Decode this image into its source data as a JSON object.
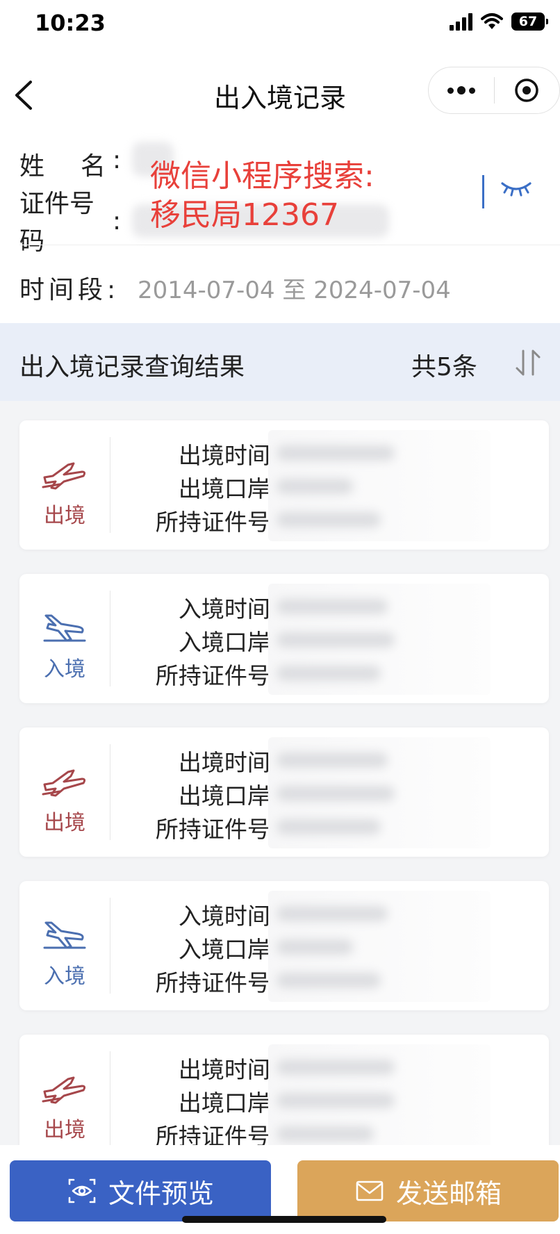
{
  "status_bar": {
    "time": "10:23",
    "battery": "67"
  },
  "nav": {
    "title": "出入境记录"
  },
  "info": {
    "name_label": "姓名",
    "id_label_line1": "证件号",
    "id_label_line2": "码",
    "colon": ":",
    "watermark_line1": "微信小程序搜索:",
    "watermark_line2": "移民局12367",
    "period_label": "时间段:",
    "period_value": "2014-07-04 至 2024-07-04"
  },
  "result": {
    "title": "出入境记录查询结果",
    "count": "共5条"
  },
  "records": [
    {
      "type": "出境",
      "kind": "exit",
      "time_label": "出境时间:",
      "port_label": "出境口岸:",
      "doc_label": "所持证件号:"
    },
    {
      "type": "入境",
      "kind": "entry",
      "time_label": "入境时间:",
      "port_label": "入境口岸:",
      "doc_label": "所持证件号:"
    },
    {
      "type": "出境",
      "kind": "exit",
      "time_label": "出境时间:",
      "port_label": "出境口岸:",
      "doc_label": "所持证件号:"
    },
    {
      "type": "入境",
      "kind": "entry",
      "time_label": "入境时间:",
      "port_label": "入境口岸:",
      "doc_label": "所持证件号:"
    },
    {
      "type": "出境",
      "kind": "exit",
      "time_label": "出境时间:",
      "port_label": "出境口岸:",
      "doc_label": "所持证件号:"
    }
  ],
  "buttons": {
    "preview_label": "文件预览",
    "email_label": "发送邮箱"
  },
  "colors": {
    "exit": "#a6474b",
    "entry": "#4b6fb0",
    "preview_button": "#3a62c4",
    "email_button": "#dba55a",
    "watermark": "#e8403a"
  },
  "icons": {
    "exit": "plane-takeoff-icon",
    "entry": "plane-landing-icon",
    "preview": "eye-preview-icon",
    "email": "envelope-icon"
  }
}
